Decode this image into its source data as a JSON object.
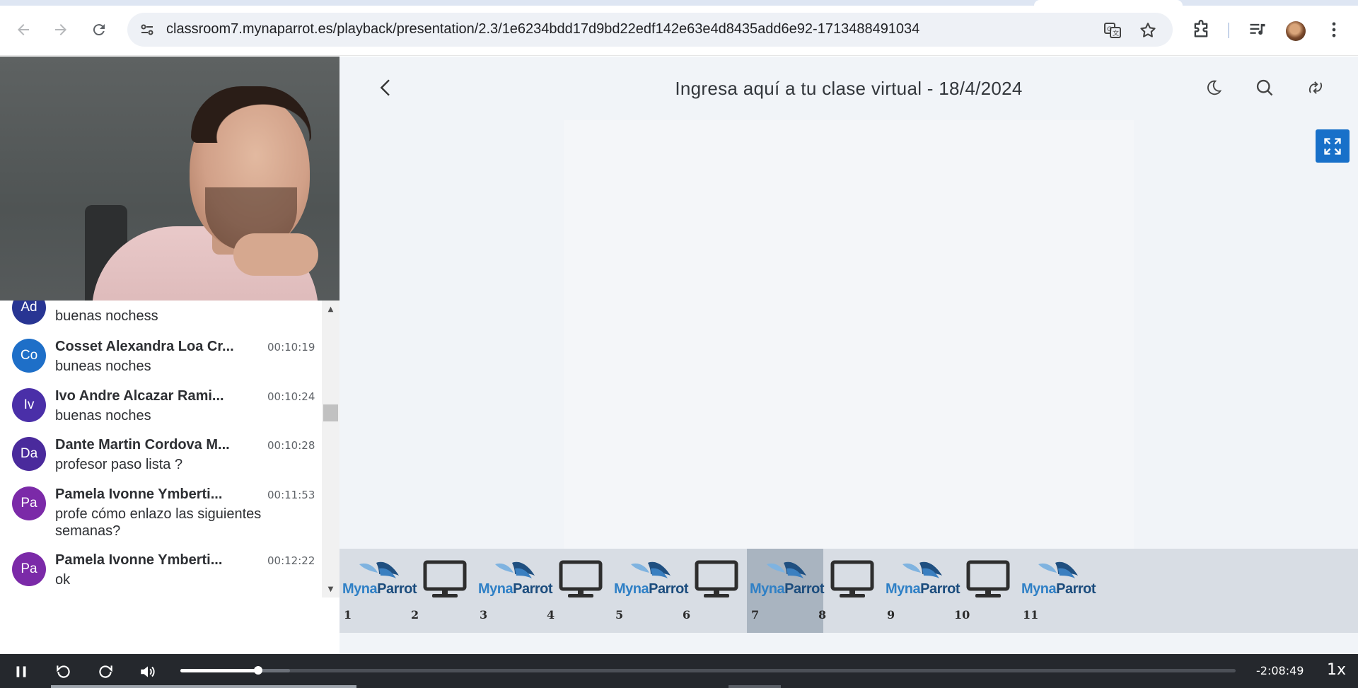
{
  "browser": {
    "url": "classroom7.mynaparrot.es/playback/presentation/2.3/1e6234bdd17d9bd22edf142e63e4d8435add6e92-1713488491034",
    "icons": [
      "back-arrow-icon",
      "forward-arrow-icon",
      "reload-icon",
      "site-settings-icon",
      "translate-icon",
      "star-icon",
      "extensions-icon",
      "media-controls-icon",
      "profile-avatar",
      "kebab-menu-icon"
    ]
  },
  "header": {
    "title": "Ingresa aquí a tu clase virtual - 18/4/2024"
  },
  "chat": {
    "messages": [
      {
        "initials": "Ad",
        "name": "",
        "time": "",
        "text": "buenas nochess",
        "color": "#283593"
      },
      {
        "initials": "Co",
        "name": "Cosset Alexandra Loa Cr...",
        "time": "00:10:19",
        "text": "buneas noches",
        "color": "#1e6fc8"
      },
      {
        "initials": "Iv",
        "name": "Ivo Andre Alcazar Rami...",
        "time": "00:10:24",
        "text": "buenas noches",
        "color": "#4a2fa8"
      },
      {
        "initials": "Da",
        "name": "Dante Martin Cordova M...",
        "time": "00:10:28",
        "text": "profesor paso lista ?",
        "color": "#4a2a9c"
      },
      {
        "initials": "Pa",
        "name": "Pamela Ivonne Ymberti...",
        "time": "00:11:53",
        "text": "profe cómo enlazo las siguientes semanas?",
        "color": "#7b2aa8"
      },
      {
        "initials": "Pa",
        "name": "Pamela Ivonne Ymberti...",
        "time": "00:12:22",
        "text": "ok",
        "color": "#7b2aa8"
      }
    ]
  },
  "thumbnails": {
    "items": [
      {
        "num": "1",
        "kind": "logo"
      },
      {
        "num": "2",
        "kind": "screen"
      },
      {
        "num": "3",
        "kind": "logo"
      },
      {
        "num": "4",
        "kind": "screen"
      },
      {
        "num": "5",
        "kind": "logo"
      },
      {
        "num": "6",
        "kind": "screen"
      },
      {
        "num": "7",
        "kind": "logo"
      },
      {
        "num": "8",
        "kind": "screen"
      },
      {
        "num": "9",
        "kind": "logo"
      },
      {
        "num": "10",
        "kind": "screen"
      },
      {
        "num": "11",
        "kind": "logo"
      }
    ],
    "active": "7",
    "logo_part1": "Myna",
    "logo_part2": "Parrot"
  },
  "player": {
    "remaining": "-2:08:49",
    "rate": "1x",
    "progress": 0.074,
    "buffered": 0.104
  },
  "colors": {
    "accent": "#1870c9",
    "player_bg": "#25282d"
  }
}
